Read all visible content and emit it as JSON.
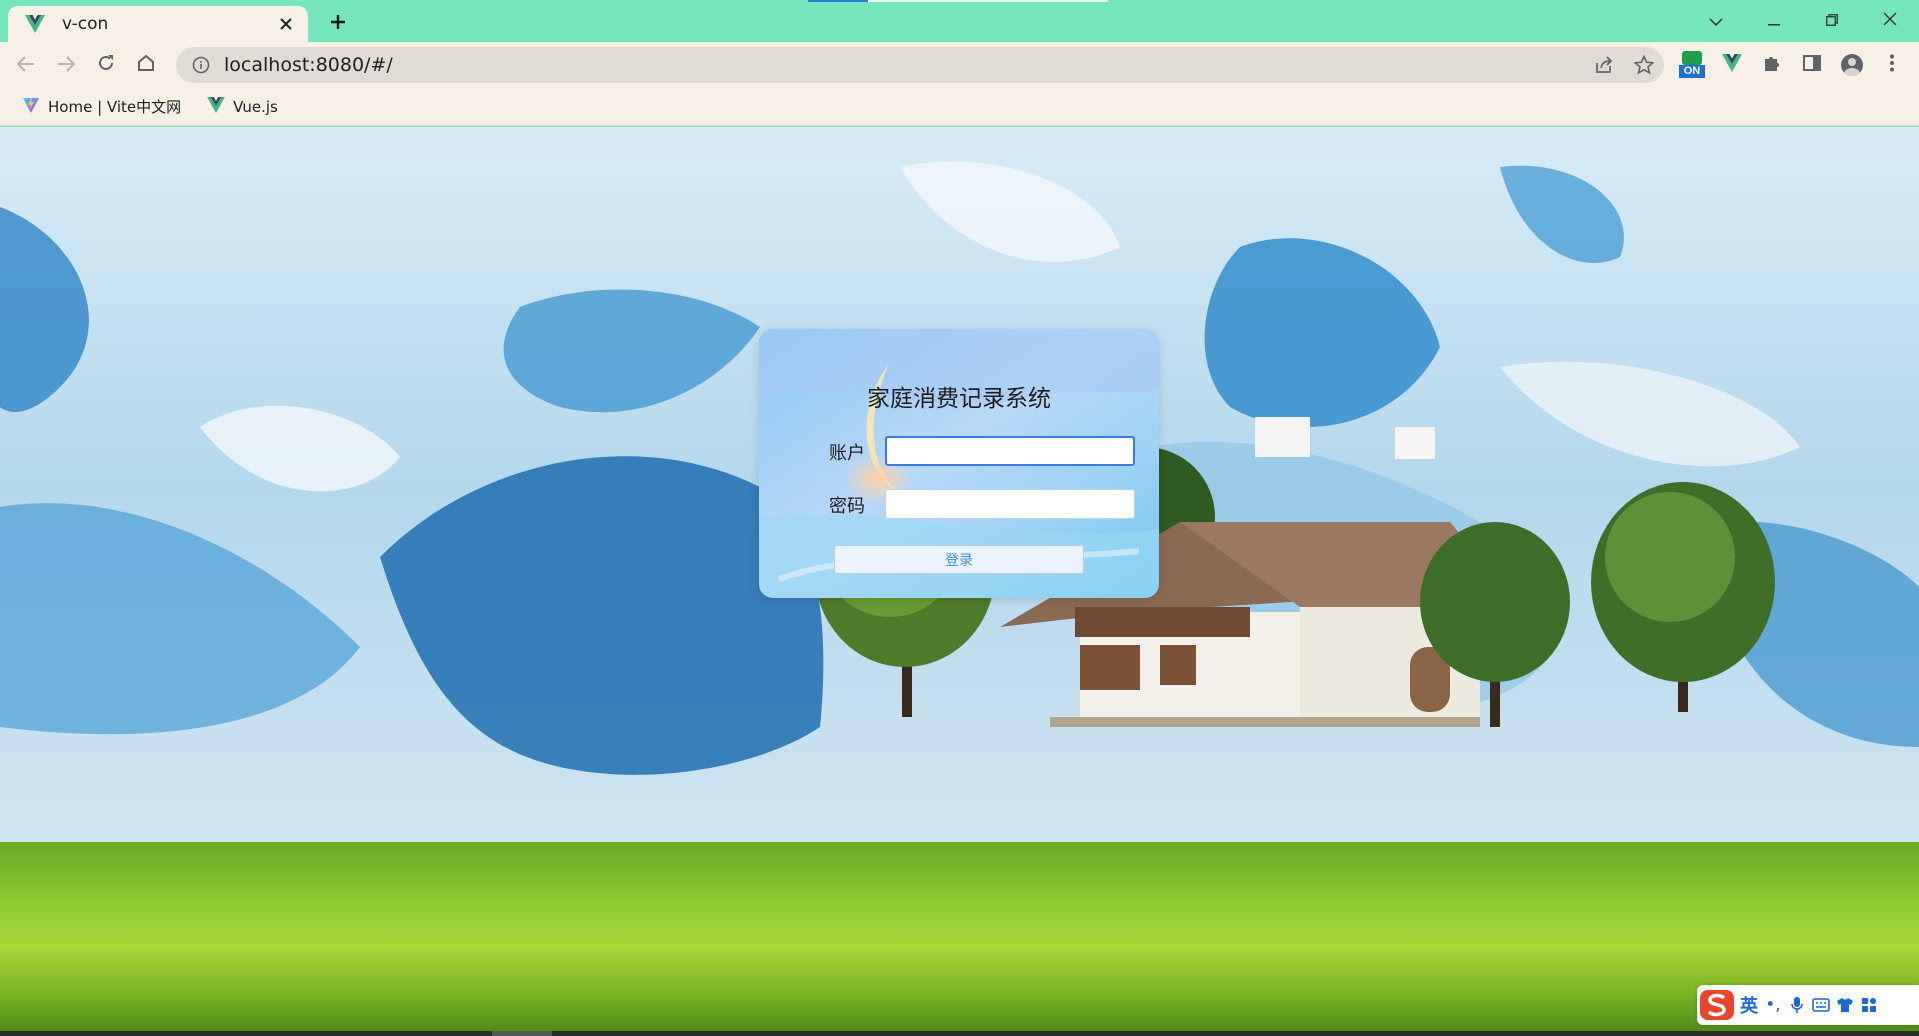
{
  "browser": {
    "tab": {
      "title": "v-con",
      "favicon": "vue-logo-icon"
    },
    "new_tab_icon": "plus-icon",
    "window_controls": [
      "chevron-down-icon",
      "minimize-icon",
      "restore-icon",
      "close-icon"
    ],
    "address": {
      "url": "localhost:8080/#/",
      "info_icon": "info-icon"
    },
    "bookmarks": [
      {
        "label": "Home | Vite中文网",
        "icon": "vite-logo-icon"
      },
      {
        "label": "Vue.js",
        "icon": "vue-logo-icon"
      }
    ],
    "extension_badge": "ON"
  },
  "login": {
    "title": "家庭消费记录系统",
    "account_label": "账户",
    "account_value": "",
    "password_label": "密码",
    "password_value": "",
    "submit_label": "登录"
  },
  "ime": {
    "language": "英",
    "punct": "•,"
  },
  "colors": {
    "titlebar": "#75e5bb",
    "toolbar": "#f6f0e6",
    "button_text": "#4a8ee0"
  }
}
